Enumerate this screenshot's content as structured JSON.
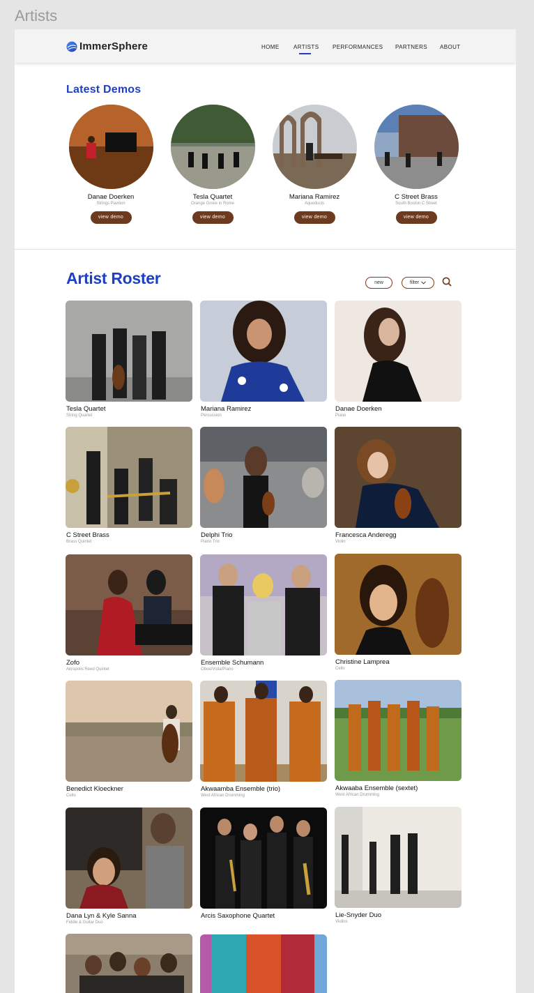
{
  "frame": {
    "label": "Artists"
  },
  "header": {
    "logo_text": "ImmerSphere",
    "nav": [
      "HOME",
      "ARTISTS",
      "PERFORMANCES",
      "PARTNERS",
      "ABOUT"
    ],
    "active_nav": "ARTISTS"
  },
  "demos": {
    "title": "Latest Demos",
    "button_label": "view demo",
    "items": [
      {
        "name": "Danae Doerken",
        "location": "Strings Pavilion"
      },
      {
        "name": "Tesla Quartet",
        "location": "Orange Grove in Rome"
      },
      {
        "name": "Mariana Ramirez",
        "location": "Aqueducts"
      },
      {
        "name": "C Street Brass",
        "location": "South Boston C Street"
      }
    ]
  },
  "roster": {
    "title": "Artist Roster",
    "new_label": "new",
    "filter_label": "filter",
    "artists": [
      {
        "name": "Tesla Quartet",
        "genre": "String Quartet"
      },
      {
        "name": "Mariana Ramirez",
        "genre": "Percussion"
      },
      {
        "name": "Danae Doerken",
        "genre": "Piano"
      },
      {
        "name": "C Street Brass",
        "genre": "Brass Quintet"
      },
      {
        "name": "Delphi Trio",
        "genre": "Piano Trio"
      },
      {
        "name": "Francesca Anderegg",
        "genre": "Violin"
      },
      {
        "name": "Zofo",
        "genre": "Akropolis Reed Quintet"
      },
      {
        "name": "Ensemble Schumann",
        "genre": "Oboe/Viola/Piano"
      },
      {
        "name": "Christine Lamprea",
        "genre": "Cello"
      },
      {
        "name": "Benedict Kloeckner",
        "genre": "Cello"
      },
      {
        "name": "Akwaamba Ensemble (trio)",
        "genre": "West African Drumming"
      },
      {
        "name": "Akwaaba Ensemble (sextet)",
        "genre": "West African Drumming"
      },
      {
        "name": "Dana Lyn & Kyle Sanna",
        "genre": "Fiddle & Guitar Duo"
      },
      {
        "name": "Arcis Saxophone Quartet",
        "genre": ""
      },
      {
        "name": "Lie-Snyder Duo",
        "genre": "Violins"
      }
    ]
  },
  "colors": {
    "accent_blue": "#1c3fc4",
    "button_brown": "#6b3a1f"
  }
}
